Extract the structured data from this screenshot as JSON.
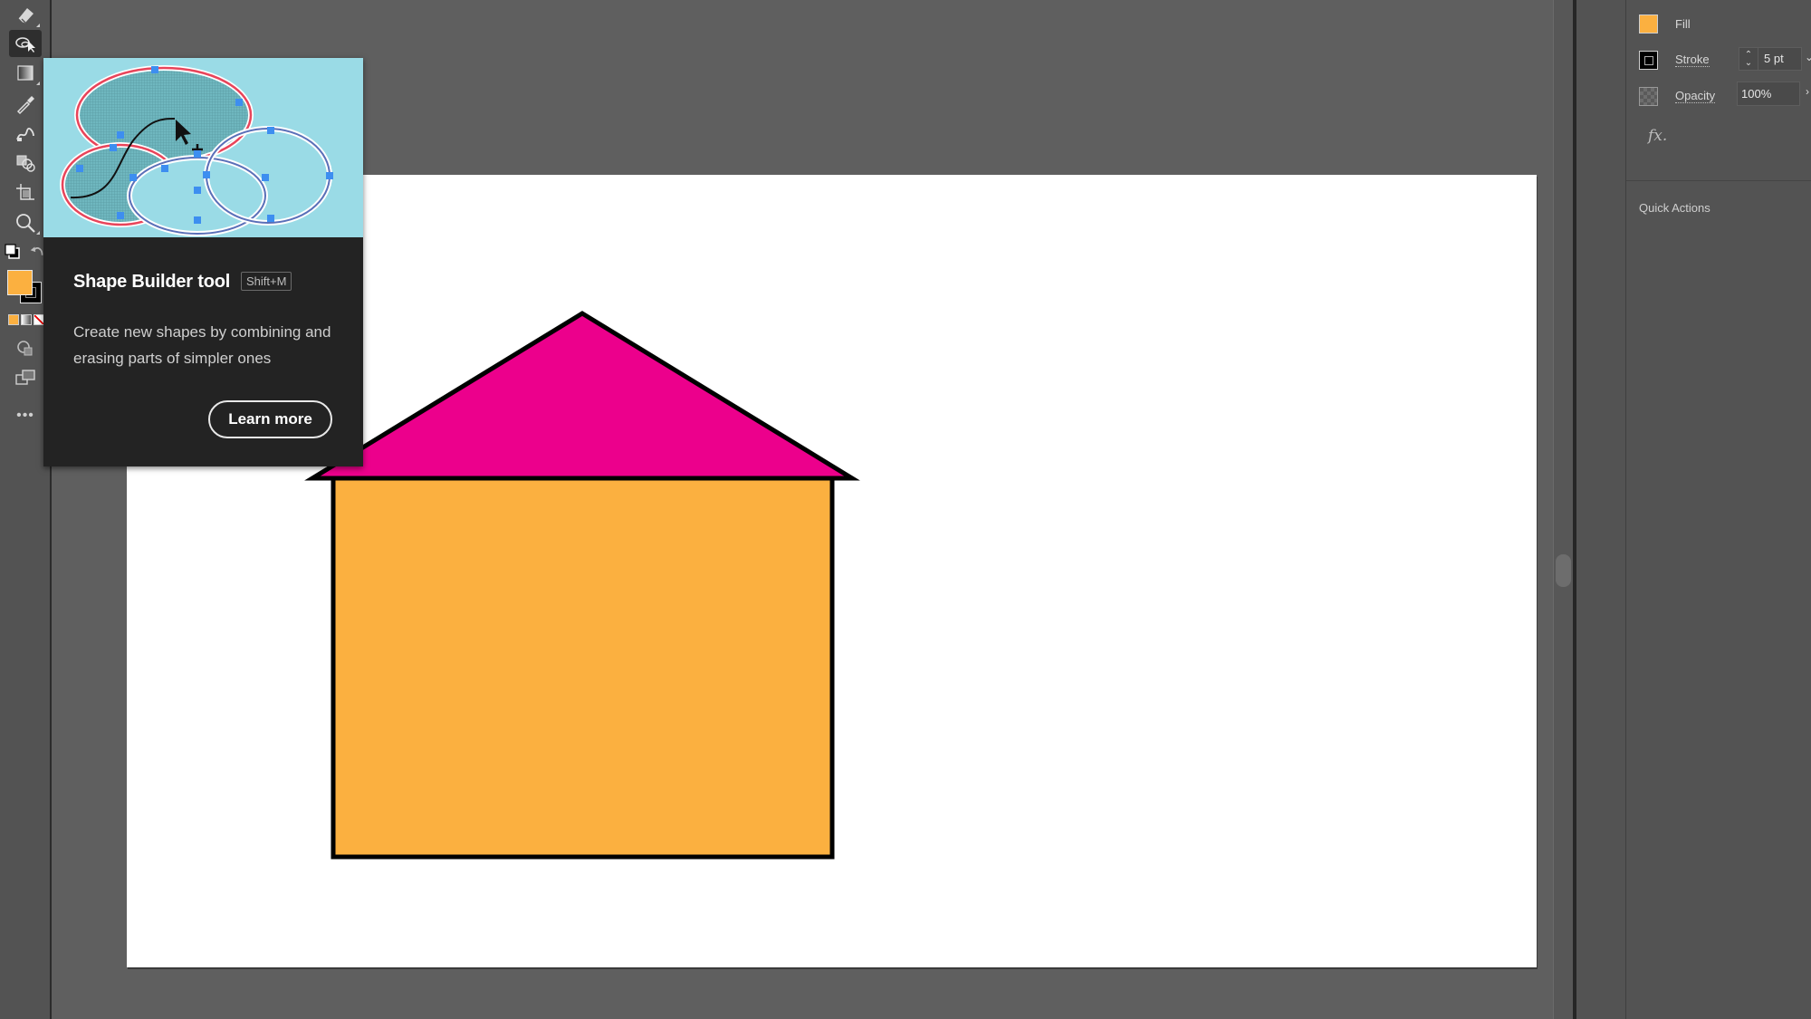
{
  "toolbar": {
    "tools": [
      {
        "name": "Eraser tool",
        "icon": "eraser-icon"
      },
      {
        "name": "Shape Builder tool",
        "icon": "shape-builder-icon",
        "active": true
      },
      {
        "name": "Gradient tool",
        "icon": "gradient-icon"
      },
      {
        "name": "Eyedropper tool",
        "icon": "eyedropper-icon"
      },
      {
        "name": "Blend tool",
        "icon": "blend-icon"
      },
      {
        "name": "Live Paint Bucket tool",
        "icon": "live-paint-icon"
      },
      {
        "name": "Artboard tool",
        "icon": "artboard-icon"
      },
      {
        "name": "Zoom tool",
        "icon": "zoom-icon"
      }
    ],
    "fill_color": "#FBB040",
    "stroke_color": "#000000",
    "more_label": "•••"
  },
  "tooltip": {
    "title": "Shape Builder tool",
    "shortcut": "Shift+M",
    "description": "Create new shapes by combining and erasing parts of simpler ones",
    "button_label": "Learn more"
  },
  "artwork": {
    "roof_color": "#EC008C",
    "wall_color": "#FBB040",
    "stroke_color": "#000000"
  },
  "properties_panel": {
    "fill_label": "Fill",
    "fill_color": "#FBB040",
    "stroke_label": "Stroke",
    "stroke_weight": "5 pt",
    "opacity_label": "Opacity",
    "opacity_value": "100%",
    "fx_label": "fx.",
    "quick_actions_label": "Quick Actions"
  }
}
